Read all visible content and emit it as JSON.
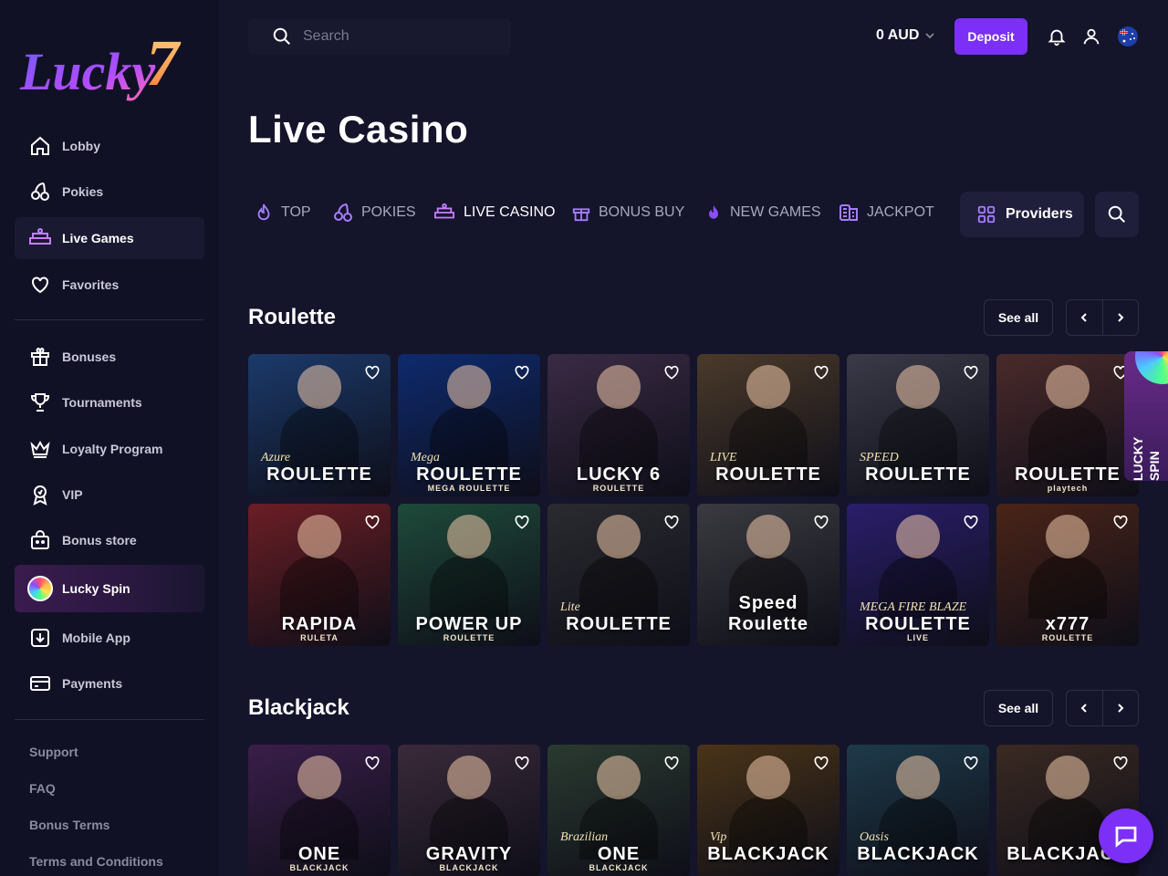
{
  "brand": {
    "logo_text": "Lucky",
    "logo_num": "7"
  },
  "sidebar": {
    "items": [
      {
        "label": "Lobby",
        "icon": "home-icon"
      },
      {
        "label": "Pokies",
        "icon": "cherries-icon"
      },
      {
        "label": "Live Games",
        "icon": "live-table-icon"
      },
      {
        "label": "Favorites",
        "icon": "heart-icon"
      },
      {
        "label": "Bonuses",
        "icon": "gift-icon"
      },
      {
        "label": "Tournaments",
        "icon": "trophy-icon"
      },
      {
        "label": "Loyalty Program",
        "icon": "crown-icon"
      },
      {
        "label": "VIP",
        "icon": "vip-badge-icon"
      },
      {
        "label": "Bonus store",
        "icon": "store-bag-icon"
      },
      {
        "label": "Lucky Spin",
        "icon": "wheel-icon"
      },
      {
        "label": "Mobile App",
        "icon": "download-icon"
      },
      {
        "label": "Payments",
        "icon": "card-icon"
      }
    ],
    "footer": [
      "Support",
      "FAQ",
      "Bonus Terms",
      "Terms and Conditions"
    ]
  },
  "header": {
    "search_placeholder": "Search",
    "balance": "0 AUD",
    "deposit_label": "Deposit"
  },
  "page_title": "Live Casino",
  "tabs": [
    {
      "label": "TOP",
      "icon": "fire-icon"
    },
    {
      "label": "POKIES",
      "icon": "cherries-icon"
    },
    {
      "label": "LIVE CASINO",
      "icon": "live-table-icon",
      "active": true
    },
    {
      "label": "BONUS BUY",
      "icon": "gift-icon"
    },
    {
      "label": "NEW GAMES",
      "icon": "flame-icon"
    },
    {
      "label": "JACKPOT",
      "icon": "coins-icon"
    }
  ],
  "providers_label": "Providers",
  "sections": {
    "roulette": {
      "title": "Roulette",
      "see_all": "See all",
      "games": [
        {
          "title": "ROULETTE",
          "sub": "",
          "accent": "Azure",
          "bg": "#1b3a6b"
        },
        {
          "title": "ROULETTE",
          "sub": "MEGA ROULETTE",
          "accent": "Mega",
          "bg": "#0e2a6e"
        },
        {
          "title": "LUCKY 6",
          "sub": "ROULETTE",
          "accent": "",
          "bg": "#3a2a44"
        },
        {
          "title": "ROULETTE",
          "sub": "",
          "accent": "LIVE",
          "bg": "#4a3a2a"
        },
        {
          "title": "ROULETTE",
          "sub": "",
          "accent": "SPEED",
          "bg": "#3a3a48"
        },
        {
          "title": "ROULETTE",
          "sub": "playtech",
          "accent": "",
          "bg": "#4a2a2a"
        },
        {
          "title": "RAPIDA",
          "sub": "RULETA",
          "accent": "",
          "bg": "#6b1e24"
        },
        {
          "title": "POWER UP",
          "sub": "ROULETTE",
          "accent": "",
          "bg": "#1e4a3a"
        },
        {
          "title": "ROULETTE",
          "sub": "",
          "accent": "Lite",
          "bg": "#2a2a30"
        },
        {
          "title": "Speed Roulette",
          "sub": "",
          "accent": "",
          "bg": "#3a3a40"
        },
        {
          "title": "ROULETTE",
          "sub": "LIVE",
          "accent": "MEGA FIRE BLAZE",
          "bg": "#2a1e6b"
        },
        {
          "title": "x777",
          "sub": "ROULETTE",
          "accent": "",
          "bg": "#4a2418"
        }
      ]
    },
    "blackjack": {
      "title": "Blackjack",
      "see_all": "See all",
      "games": [
        {
          "title": "ONE",
          "sub": "BLACKJACK",
          "accent": "",
          "bg": "#3a1e4a"
        },
        {
          "title": "GRAVITY",
          "sub": "BLACKJACK",
          "accent": "",
          "bg": "#3a2a3a"
        },
        {
          "title": "ONE",
          "sub": "BLACKJACK",
          "accent": "Brazilian",
          "bg": "#2a3a30"
        },
        {
          "title": "BLACKJACK",
          "sub": "",
          "accent": "Vip",
          "bg": "#4a3418"
        },
        {
          "title": "BLACKJACK",
          "sub": "",
          "accent": "Oasis",
          "bg": "#1e3a4a"
        },
        {
          "title": "BLACKJACK",
          "sub": "",
          "accent": "",
          "bg": "#3a2a22"
        }
      ]
    }
  },
  "side_widget": {
    "label": "LUCKY SPIN"
  },
  "colors": {
    "accent": "#7b2ff7",
    "bg": "#14142b",
    "sidebar": "#111126"
  }
}
